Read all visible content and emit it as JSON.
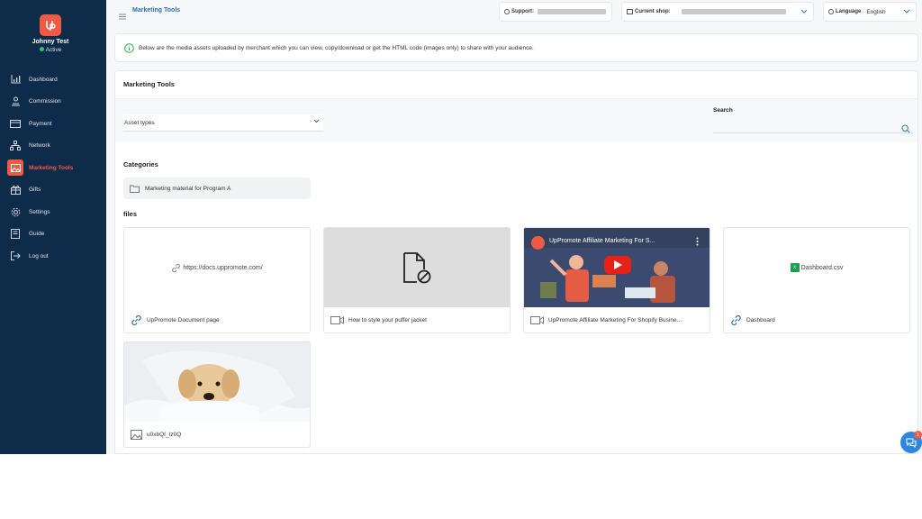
{
  "colors": {
    "sidebar_bg": "#0f2b4a",
    "accent": "#ef5a45",
    "link_blue": "#2f6fb0",
    "status_green": "#2ec27e",
    "chat_blue": "#2e86de"
  },
  "user": {
    "name": "Johnny Test",
    "status": "Active"
  },
  "sidebar": {
    "items": [
      {
        "label": "Dashboard",
        "icon": "bar-chart-icon"
      },
      {
        "label": "Commission",
        "icon": "commission-icon"
      },
      {
        "label": "Payment",
        "icon": "card-icon"
      },
      {
        "label": "Network",
        "icon": "network-icon"
      },
      {
        "label": "Marketing Tools",
        "icon": "image-icon",
        "active": true
      },
      {
        "label": "Gifts",
        "icon": "gift-icon"
      },
      {
        "label": "Settings",
        "icon": "gear-icon"
      },
      {
        "label": "Guide",
        "icon": "book-icon"
      },
      {
        "label": "Log out",
        "icon": "logout-icon"
      }
    ]
  },
  "topbar": {
    "breadcrumb": "Marketing Tools",
    "support_label": "Support:",
    "shop_label": "Current shop:",
    "language_label": "Language",
    "language_value": "English"
  },
  "banner": {
    "text": "Below are the media assets uploaded by merchant which you can view, copy/download or get the HTML code (images only) to share with your audience."
  },
  "main": {
    "title": "Marketing Tools",
    "asset_select": "Asset types",
    "search_label": "Search",
    "categories_heading": "Categories",
    "category": "Marketing material for Program A",
    "files_heading": "files",
    "files": [
      {
        "name": "UpPromote Document page",
        "preview": "https://docs.uppromote.com/",
        "type": "link"
      },
      {
        "name": "How to style your puffer jacket",
        "preview": "",
        "type": "video"
      },
      {
        "name": "UpPromote Affiliate Marketing For Shopify Busine...",
        "preview": "UpPromote Affiliate Marketing For S...",
        "type": "video"
      },
      {
        "name": "Dashboard",
        "preview": "Dashboard.csv",
        "type": "link"
      },
      {
        "name": "u0xbQI_Iz0Q",
        "preview": "",
        "type": "image"
      }
    ]
  },
  "chat": {
    "badge": "1"
  }
}
